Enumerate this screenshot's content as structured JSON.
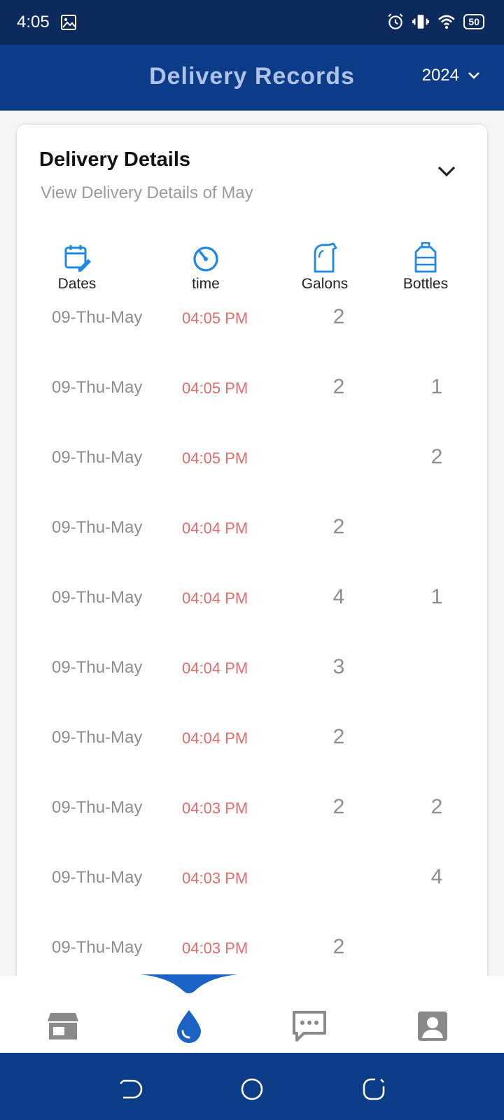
{
  "status_bar": {
    "time": "4:05",
    "battery": "50",
    "icons": [
      "image-icon",
      "alarm-icon",
      "vibrate-icon",
      "wifi-icon",
      "battery-icon"
    ]
  },
  "header": {
    "title": "Delivery Records",
    "year": "2024"
  },
  "card": {
    "title": "Delivery Details",
    "subtitle": "View Delivery Details of May",
    "columns": [
      {
        "label": "Dates",
        "icon": "calendar-edit-icon"
      },
      {
        "label": "time",
        "icon": "timer-icon"
      },
      {
        "label": "Galons",
        "icon": "gallon-jug-icon"
      },
      {
        "label": "Bottles",
        "icon": "water-bottle-icon"
      }
    ],
    "rows": [
      {
        "date": "09-Thu-May",
        "time": "04:05 PM",
        "galons": "2",
        "bottles": ""
      },
      {
        "date": "09-Thu-May",
        "time": "04:05 PM",
        "galons": "2",
        "bottles": "1"
      },
      {
        "date": "09-Thu-May",
        "time": "04:05 PM",
        "galons": "",
        "bottles": "2"
      },
      {
        "date": "09-Thu-May",
        "time": "04:04 PM",
        "galons": "2",
        "bottles": ""
      },
      {
        "date": "09-Thu-May",
        "time": "04:04 PM",
        "galons": "4",
        "bottles": "1"
      },
      {
        "date": "09-Thu-May",
        "time": "04:04 PM",
        "galons": "3",
        "bottles": ""
      },
      {
        "date": "09-Thu-May",
        "time": "04:04 PM",
        "galons": "2",
        "bottles": ""
      },
      {
        "date": "09-Thu-May",
        "time": "04:03 PM",
        "galons": "2",
        "bottles": "2"
      },
      {
        "date": "09-Thu-May",
        "time": "04:03 PM",
        "galons": "",
        "bottles": "4"
      },
      {
        "date": "09-Thu-May",
        "time": "04:03 PM",
        "galons": "2",
        "bottles": ""
      }
    ]
  },
  "bottom_nav": {
    "items": [
      "store-icon",
      "water-drop-icon",
      "chat-icon",
      "profile-icon"
    ],
    "active": "water-drop-icon"
  },
  "colors": {
    "status_bar": "#0d2a5c",
    "app_bar": "#0c3c88",
    "accent": "#1976d2",
    "time_text": "#e06b6b"
  }
}
